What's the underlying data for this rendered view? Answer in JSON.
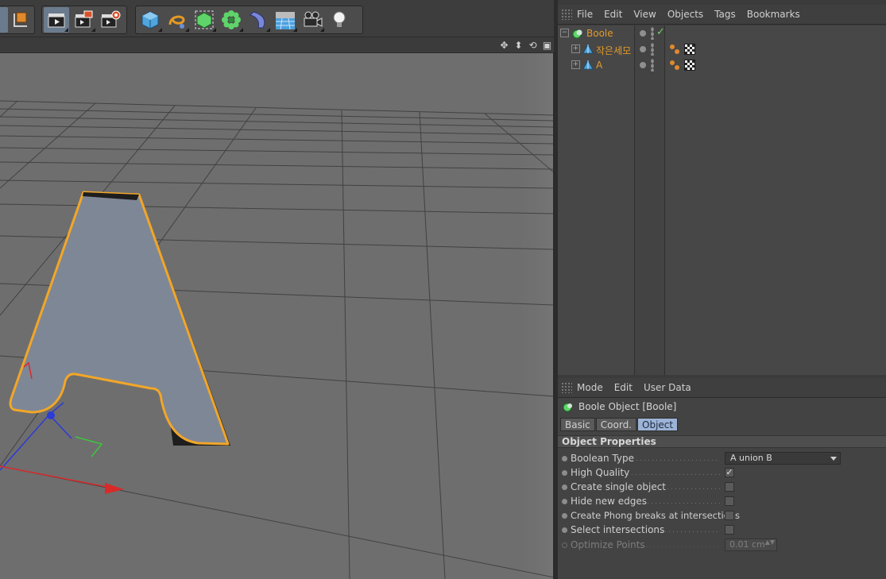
{
  "object_manager": {
    "menu": [
      "File",
      "Edit",
      "View",
      "Objects",
      "Tags",
      "Bookmarks"
    ],
    "objects": [
      {
        "name": "Boole",
        "expander": "−"
      },
      {
        "name": "작은세모",
        "expander": "+"
      },
      {
        "name": "A",
        "expander": "+"
      }
    ]
  },
  "attribute_manager": {
    "menu": [
      "Mode",
      "Edit",
      "User Data"
    ],
    "title": "Boole Object [Boole]",
    "tabs": [
      "Basic",
      "Coord.",
      "Object"
    ],
    "section": "Object Properties",
    "properties": {
      "boolean_type": {
        "label": "Boolean Type",
        "value": "A union B"
      },
      "high_quality": {
        "label": "High Quality",
        "checked": "✓"
      },
      "create_single": {
        "label": "Create single object",
        "checked": ""
      },
      "hide_edges": {
        "label": "Hide new edges",
        "checked": ""
      },
      "phong_breaks": {
        "label": "Create Phong breaks at intersections",
        "checked": ""
      },
      "select_intersections": {
        "label": "Select intersections",
        "checked": ""
      },
      "optimize_points": {
        "label": "Optimize Points",
        "value": "0.01 cm",
        "spin": "▲▼"
      }
    }
  },
  "colors": {
    "selection_outline": "#f2a628",
    "object_name": "#e29a2a",
    "active_tab": "#9cb3d6",
    "viewport_bg": "#6e6e6e"
  }
}
